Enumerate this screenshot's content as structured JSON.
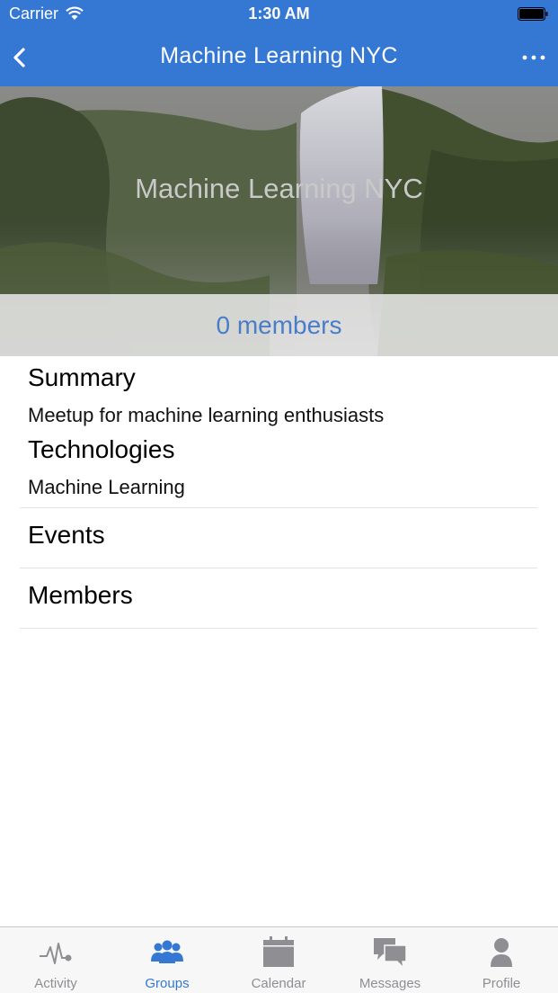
{
  "status_bar": {
    "carrier": "Carrier",
    "time": "1:30 AM"
  },
  "nav": {
    "title": "Machine Learning NYC",
    "back_icon": "chevron-left-icon",
    "more_icon": "ellipsis-icon"
  },
  "hero": {
    "title": "Machine Learning NYC",
    "members_label": "0 members"
  },
  "details": {
    "summary_heading": "Summary",
    "summary_text": "Meetup for machine learning enthusiasts",
    "technologies_heading": "Technologies",
    "technologies_text": "Machine Learning"
  },
  "rows": [
    {
      "label": "Events"
    },
    {
      "label": "Members"
    }
  ],
  "tabbar": {
    "tabs": [
      {
        "label": "Activity",
        "icon": "activity-pulse-icon",
        "active": false
      },
      {
        "label": "Groups",
        "icon": "groups-icon",
        "active": true
      },
      {
        "label": "Calendar",
        "icon": "calendar-icon",
        "active": false
      },
      {
        "label": "Messages",
        "icon": "messages-icon",
        "active": false
      },
      {
        "label": "Profile",
        "icon": "profile-icon",
        "active": false
      }
    ]
  },
  "colors": {
    "brand_blue": "#3478d4",
    "link_blue": "#4a7dc9",
    "inactive_gray": "#8e8e93"
  }
}
